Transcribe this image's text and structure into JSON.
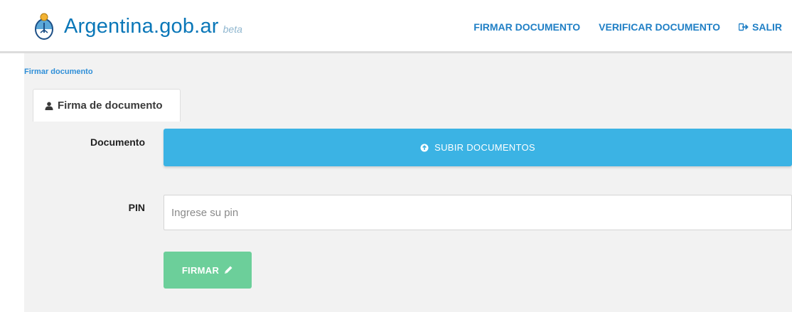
{
  "header": {
    "brand_name": "Argentina.gob.ar",
    "brand_tag": "beta",
    "nav": [
      {
        "label": "FIRMAR DOCUMENTO"
      },
      {
        "label": "VERIFICAR DOCUMENTO"
      },
      {
        "label": "SALIR",
        "icon": "sign-out-icon"
      }
    ]
  },
  "breadcrumb": "Firmar documento",
  "tab": {
    "label": "Firma de documento",
    "icon": "user-icon"
  },
  "form": {
    "document_label": "Documento",
    "upload_button_label": "SUBIR DOCUMENTOS",
    "upload_icon": "upload-circle-icon",
    "pin_label": "PIN",
    "pin_placeholder": "Ingrese su pin",
    "pin_value": "",
    "sign_button_label": "FIRMAR",
    "sign_icon": "pencil-icon"
  },
  "colors": {
    "brand_blue": "#0a77b8",
    "nav_blue": "#1f7fc5",
    "upload_button": "#3bb3e4",
    "sign_button": "#6ccf9a",
    "content_bg": "#f2f2f2"
  }
}
